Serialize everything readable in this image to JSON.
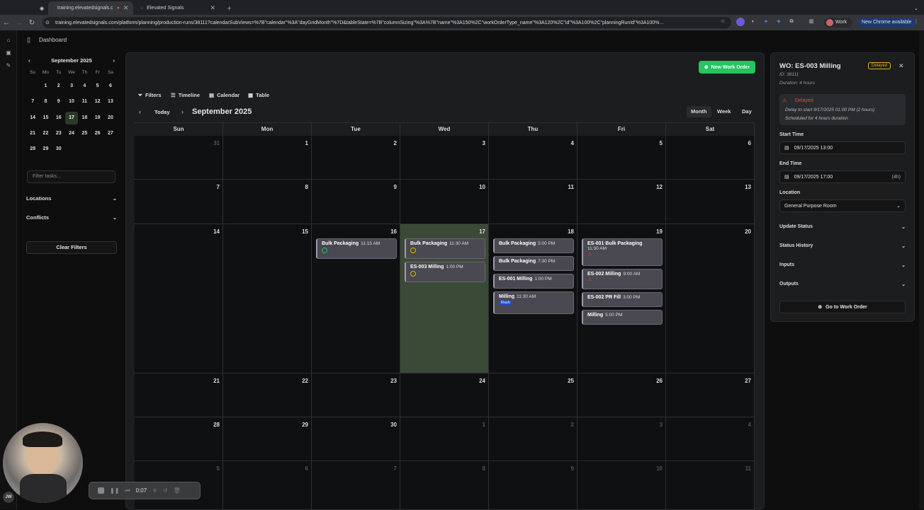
{
  "browser": {
    "tabs": [
      {
        "label": "training.elevatedsignals.c"
      },
      {
        "label": "Elevated Signals"
      }
    ],
    "url": "training.elevatedsignals.com/platform/planning/production-runs/38111?calendarSubViews=%7B\"calendar\"%3A\"dayGridMonth\"%7D&tableState=%7B\"columnSizing\"%3A%7B\"name\"%3A150%2C\"workOrderType_name\"%3A120%2C\"id\"%3A100%2C\"planningRunId\"%3A100%...",
    "profile": "Work",
    "chrome_badge": "New Chrome available"
  },
  "header": {
    "title": "Dashboard"
  },
  "mini_calendar": {
    "month": "September 2025",
    "dow": [
      "Su",
      "Mo",
      "Tu",
      "We",
      "Th",
      "Fr",
      "Sa"
    ],
    "days": [
      "",
      "1",
      "2",
      "3",
      "4",
      "5",
      "6",
      "7",
      "8",
      "9",
      "10",
      "11",
      "12",
      "13",
      "14",
      "15",
      "16",
      "17",
      "18",
      "19",
      "20",
      "21",
      "22",
      "23",
      "24",
      "25",
      "26",
      "27",
      "28",
      "29",
      "30",
      "",
      "",
      "",
      ""
    ],
    "selected": "17"
  },
  "sidebar": {
    "filter_placeholder": "Filter tasks...",
    "locations": "Locations",
    "conflicts": "Conflicts",
    "clear_filters": "Clear Filters"
  },
  "toolbar": {
    "new_work_order": "New Work Order",
    "filters": "Filters",
    "timeline": "Timeline",
    "calendar": "Calendar",
    "table": "Table",
    "today": "Today",
    "month_title": "September 2025",
    "month": "Month",
    "week": "Week",
    "day": "Day"
  },
  "calendar": {
    "weekdays": [
      "Sun",
      "Mon",
      "Tue",
      "Wed",
      "Thu",
      "Fri",
      "Sat"
    ],
    "weeks": [
      [
        "31",
        "1",
        "2",
        "3",
        "4",
        "5",
        "6"
      ],
      [
        "7",
        "8",
        "9",
        "10",
        "11",
        "12",
        "13"
      ],
      [
        "14",
        "15",
        "16",
        "17",
        "18",
        "19",
        "20"
      ],
      [
        "21",
        "22",
        "23",
        "24",
        "25",
        "26",
        "27"
      ],
      [
        "28",
        "29",
        "30",
        "1",
        "2",
        "3",
        "4"
      ],
      [
        "5",
        "6",
        "7",
        "8",
        "9",
        "10",
        "11"
      ]
    ],
    "events": {
      "tue16": [
        {
          "name": "Bulk Packaging",
          "time": "11:15 AM"
        }
      ],
      "wed17": [
        {
          "name": "Bulk Packaging",
          "time": "11:30 AM"
        },
        {
          "name": "ES-003 Milling",
          "time": "1:00 PM"
        }
      ],
      "thu18": [
        {
          "name": "Bulk Packaging",
          "time": "5:00 PM"
        },
        {
          "name": "Bulk Packaging",
          "time": "7:30 PM"
        },
        {
          "name": "ES-001 Milling",
          "time": "1:00 PM"
        },
        {
          "name": "Milling",
          "time": "11:30 AM",
          "tag": "Rush"
        }
      ],
      "fri19": [
        {
          "name": "ES-001 Bulk Packaging",
          "time": "11:30 AM"
        },
        {
          "name": "ES-002 Milling",
          "time": "9:00 AM"
        },
        {
          "name": "ES-002 PR Fill",
          "time": "3:00 PM"
        },
        {
          "name": "Milling",
          "time": "5:00 PM"
        }
      ]
    }
  },
  "detail": {
    "title": "WO: ES-003 Milling",
    "badge": "Delayed",
    "id": "ID: 38111",
    "duration": "Duration: 4 hours",
    "alert_title": "Delayed",
    "alert_line1": "Delay to start 9/17/2025 01:00 PM (2 hours)",
    "alert_line2": "Scheduled for 4 hours duration",
    "start_label": "Start Time",
    "start_value": "09/17/2025 13:00",
    "end_label": "End Time",
    "end_value": "09/17/2025 17:00",
    "end_hint": "(4h)",
    "location_label": "Location",
    "location_value": "General Purpose Room",
    "update_status": "Update Status",
    "status_history": "Status History",
    "inputs": "Inputs",
    "outputs": "Outputs",
    "go_to": "Go to Work Order"
  },
  "recorder": {
    "time": "0:07"
  },
  "user": {
    "initials": "JW"
  },
  "colors": {
    "accent": "#22c55e",
    "today": "#3b4a37",
    "delayed": "#eab308",
    "rush": "#1d4ed8",
    "warn": "#ef4444"
  }
}
